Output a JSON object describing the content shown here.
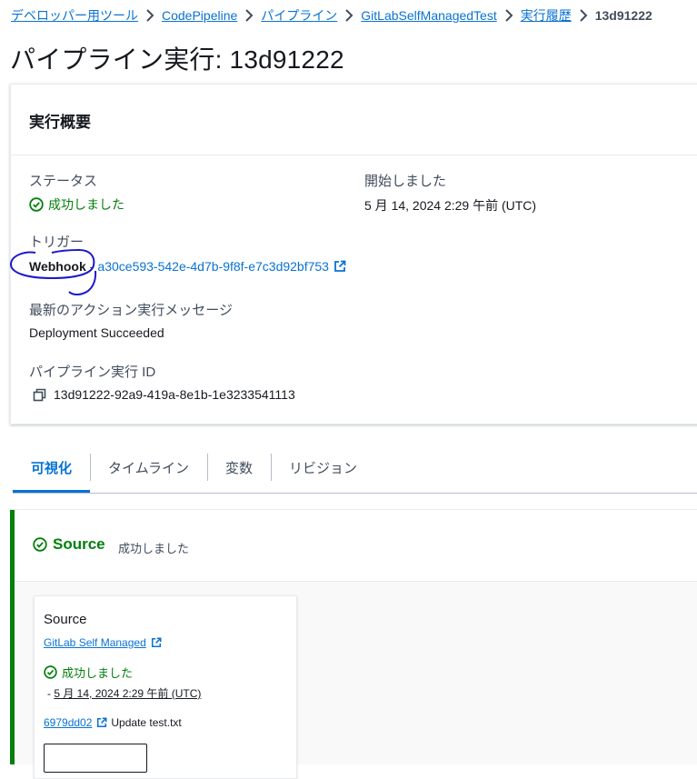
{
  "breadcrumb": {
    "items": [
      "デベロッパー用ツール",
      "CodePipeline",
      "パイプライン",
      "GitLabSelfManagedTest",
      "実行履歴"
    ],
    "current": "13d91222"
  },
  "page_title": "パイプライン実行: 13d91222",
  "summary": {
    "title": "実行概要",
    "status_label": "ステータス",
    "status_value": "成功しました",
    "started_label": "開始しました",
    "started_value": "5 月 14, 2024 2:29 午前 (UTC)",
    "trigger_label": "トリガー",
    "trigger_type": "Webhook",
    "trigger_separator": "-",
    "trigger_id": "a30ce593-542e-4d7b-9f8f-e7c3d92bf753",
    "message_label": "最新のアクション実行メッセージ",
    "message_value": "Deployment Succeeded",
    "execution_id_label": "パイプライン実行 ID",
    "execution_id_value": "13d91222-92a9-419a-8e1b-1e3233541113"
  },
  "tabs": [
    "可視化",
    "タイムライン",
    "変数",
    "リビジョン"
  ],
  "active_tab": "可視化",
  "stage": {
    "name": "Source",
    "status": "成功しました",
    "action": {
      "name": "Source",
      "provider": "GitLab Self Managed",
      "status": "成功しました",
      "time_prefix": "-",
      "time": "5 月 14, 2024 2:29 午前 (UTC)",
      "commit_id": "6979dd02",
      "commit_message": "Update test.txt"
    }
  },
  "colors": {
    "link": "#0972d3",
    "success": "#037f0c",
    "annotation": "#1a1acc"
  },
  "icons": {
    "breadcrumb_separator": "chevron-right-icon",
    "success": "status-success-icon",
    "external": "external-link-icon",
    "copy": "copy-icon"
  }
}
